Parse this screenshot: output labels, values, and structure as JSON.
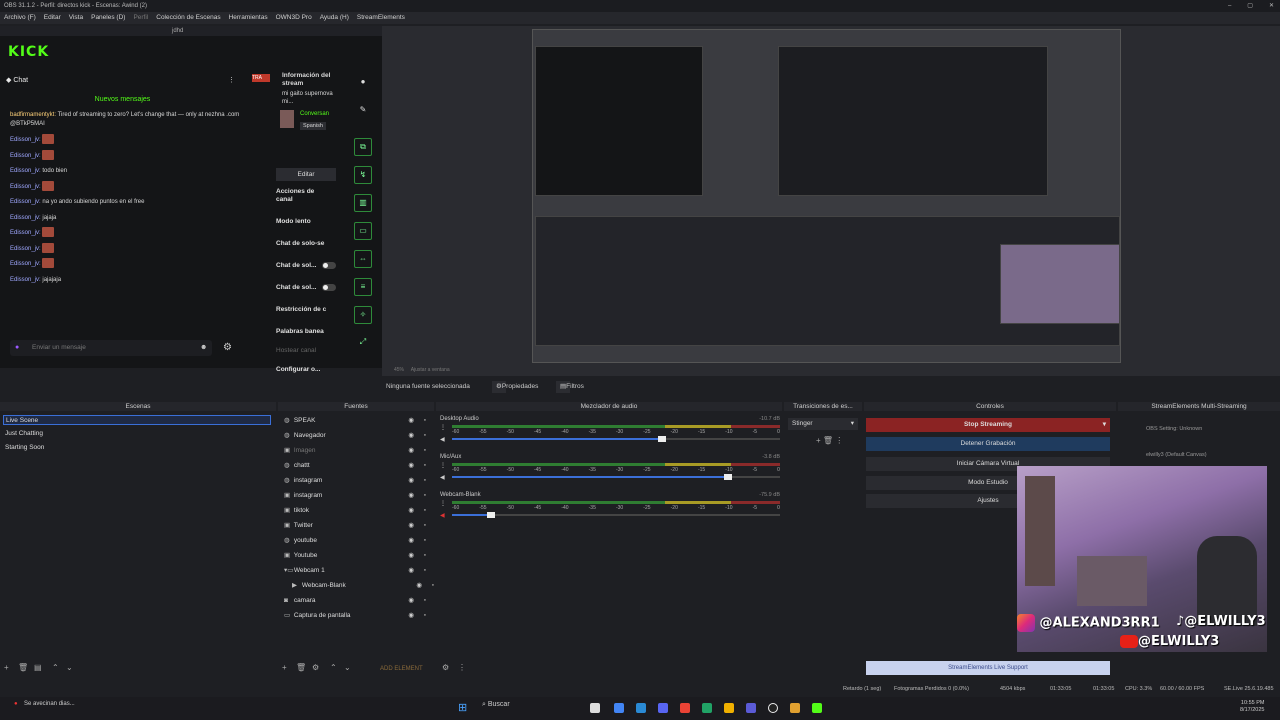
{
  "window": {
    "title": "OBS 31.1.2 - Perfil: directos kick - Escenas: Awind (2)",
    "controls": [
      "–",
      "▢",
      "✕"
    ]
  },
  "menu": [
    "Archivo (F)",
    "Editar",
    "Vista",
    "Paneles (D)",
    "Perfil",
    "Colección de Escenas",
    "Herramientas",
    "OWN3D Pro",
    "Ayuda (H)",
    "StreamElements"
  ],
  "chat": {
    "dock_title": "jdhd",
    "logo": "KICK",
    "title": "Chat",
    "new_messages": "Nuevos mensajes",
    "first_user": "badfirmamentykt:",
    "first_text": "Tired of streaming to zero? Let's change that — only at nezhna .com @BTkP5MAI",
    "messages": [
      {
        "user": "Edisson_jv:",
        "text": "",
        "emote": true
      },
      {
        "user": "Edisson_jv:",
        "text": "",
        "emote": true
      },
      {
        "user": "Edisson_jv:",
        "text": "todo bien",
        "emote": false
      },
      {
        "user": "Edisson_jv:",
        "text": "",
        "emote": true
      },
      {
        "user": "Edisson_jv:",
        "text": "na yo ando subiendo puntos en el free",
        "emote": false
      },
      {
        "user": "Edisson_jv:",
        "text": "jajaja",
        "emote": false
      },
      {
        "user": "Edisson_jv:",
        "text": "",
        "emote": true
      },
      {
        "user": "Edisson_jv:",
        "text": "",
        "emote": true
      },
      {
        "user": "Edisson_jv:",
        "text": "",
        "emote": true
      },
      {
        "user": "Edisson_jv:",
        "text": "jajajaja",
        "emote": false
      }
    ],
    "input_placeholder": "Enviar un mensaje"
  },
  "stream_panel": {
    "info_title": "Información del stream",
    "info_sub": "mi gaito supernova mi...",
    "tag": "TRA",
    "category": "Conversan",
    "language": "Spanish",
    "edit": "Editar",
    "actions": "Acciones de canal",
    "items": [
      "Modo lento",
      "Chat de solo-se",
      "Chat de sol...",
      "Chat de sol...",
      "Restricción de c",
      "Palabras banea",
      "Hostear canal",
      "Configurar o..."
    ]
  },
  "preview": {
    "zoom": "45%",
    "fit": "Ajustar a ventana"
  },
  "source_bar": {
    "none": "Ninguna fuente seleccionada",
    "props": "Propiedades",
    "filters": "Filtros"
  },
  "docks": {
    "scenes": "Escenas",
    "sources": "Fuentes",
    "mixer": "Mezclador de audio",
    "transitions": "Transiciones de es...",
    "controls": "Controles",
    "multistream": "StreamElements Multi-Streaming"
  },
  "scenes": [
    "Live Scene",
    "Just Chatting",
    "Starting Soon"
  ],
  "sources": [
    {
      "name": "SPEAK",
      "icon": "globe",
      "dim": false
    },
    {
      "name": "Navegador",
      "icon": "globe",
      "dim": false
    },
    {
      "name": "Imagen",
      "icon": "image",
      "dim": true
    },
    {
      "name": "chattt",
      "icon": "globe",
      "dim": false
    },
    {
      "name": "instagram",
      "icon": "globe",
      "dim": false
    },
    {
      "name": "instagram",
      "icon": "image",
      "dim": false
    },
    {
      "name": "tiktok",
      "icon": "image",
      "dim": false
    },
    {
      "name": "Twitter",
      "icon": "image",
      "dim": false
    },
    {
      "name": "youtube",
      "icon": "globe",
      "dim": false
    },
    {
      "name": "Youtube",
      "icon": "image",
      "dim": false
    },
    {
      "name": "Webcam 1",
      "icon": "folder",
      "dim": false
    },
    {
      "name": "Webcam-Blank",
      "icon": "play",
      "dim": false
    },
    {
      "name": "camara",
      "icon": "camera",
      "dim": false
    },
    {
      "name": "Captura de pantalla",
      "icon": "monitor",
      "dim": false
    }
  ],
  "add_element": "ADD ELEMENT",
  "mixer": [
    {
      "name": "Desktop Audio",
      "db": "-10.7 dB",
      "level": 0.64
    },
    {
      "name": "Mic/Aux",
      "db": "-3.8 dB",
      "level": 0.84
    },
    {
      "name": "Webcam-Blank",
      "db": "-75.9 dB",
      "level": 0.12
    }
  ],
  "mixer_scale": [
    "-60",
    "-55",
    "-50",
    "-45",
    "-40",
    "-35",
    "-30",
    "-25",
    "-20",
    "-15",
    "-10",
    "-5",
    "0"
  ],
  "transition": "Stinger",
  "controls": {
    "stop": "Stop Streaming",
    "stop_rec": "Detener Grabación",
    "virtual_cam": "Iniciar Cámara Virtual",
    "studio": "Modo Estudio",
    "settings": "Ajustes",
    "support": "StreamElements Live Support"
  },
  "multistream": {
    "setting": "OBS Setting: Unknown",
    "channel": "elwilly3 (Default Canvas)"
  },
  "overlay": {
    "instagram": "@ALEXAND3RR1",
    "tiktok": "@ELWILLY3",
    "youtube": "@ELWILLY3"
  },
  "status": {
    "delay": "Retardo (1 seg)",
    "dropped": "Fotogramas Perdidos 0 (0.0%)",
    "kbps": "4504 kbps",
    "live_time": "01:33:05",
    "rec_time": "01:33:05",
    "cpu": "CPU: 3.3%",
    "fps": "60.00 / 60.00 FPS",
    "se_live": "SE.Live 25.6.19.485"
  },
  "taskbar": {
    "notice": "Se avecinan dias...",
    "search": "Buscar",
    "time": "10:55 PM",
    "date": "8/17/2025"
  },
  "colors": {
    "kick_green": "#53fc18",
    "stop_red": "#8b2323",
    "selected_blue": "#3a6fd8"
  }
}
